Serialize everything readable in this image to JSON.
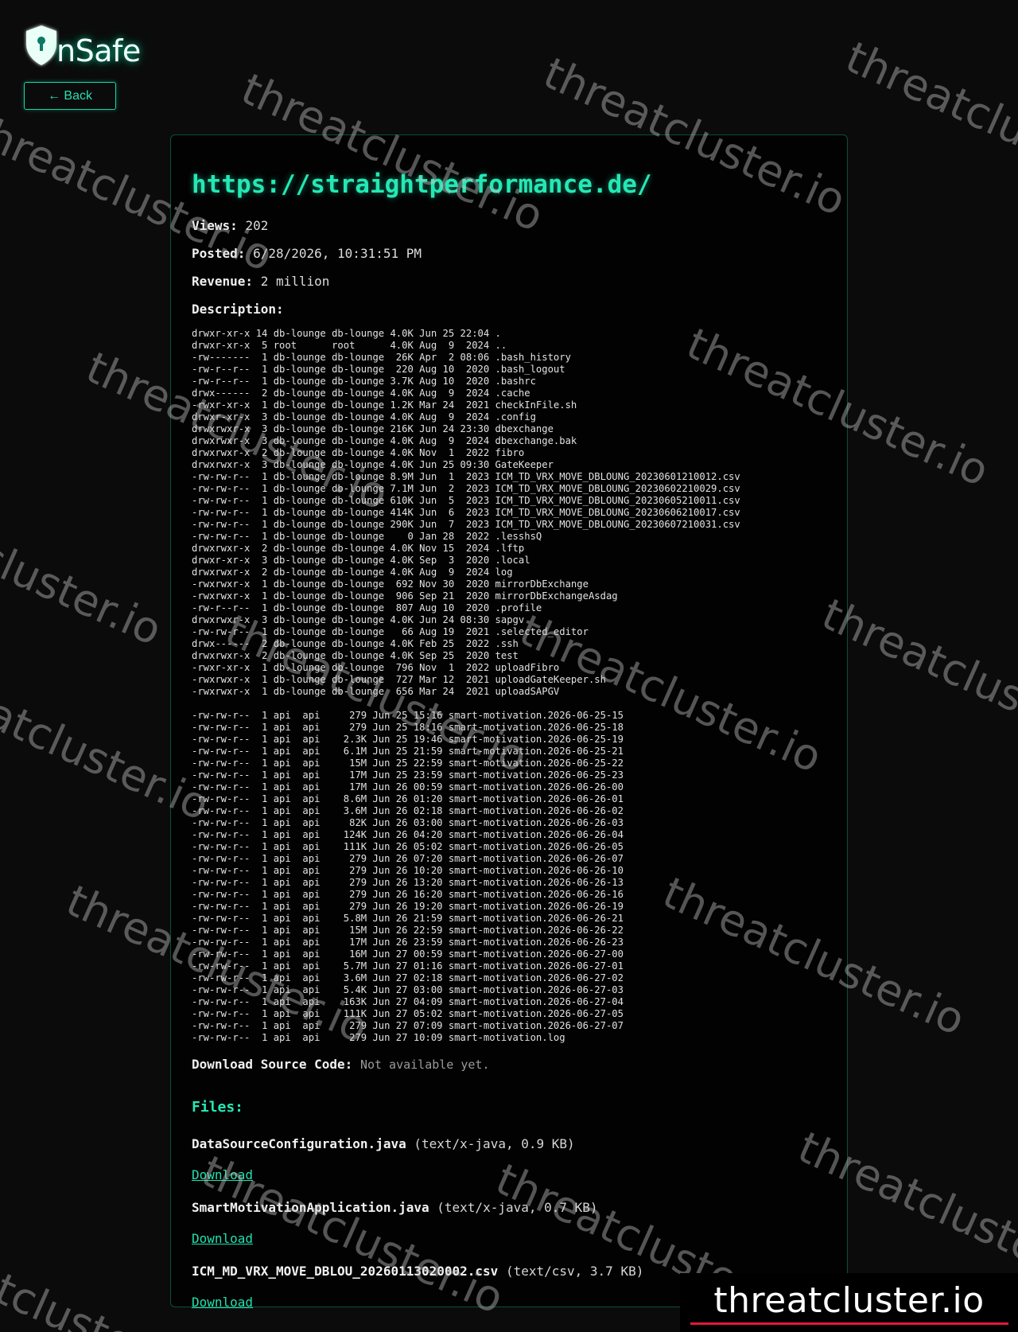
{
  "brand": {
    "name": "nSafe"
  },
  "nav": {
    "back_label": "← Back"
  },
  "post": {
    "url": "https://straightperformance.de/",
    "views_label": "Views:",
    "views": "202",
    "posted_label": "Posted:",
    "posted": "6/28/2026, 10:31:51 PM",
    "revenue_label": "Revenue:",
    "revenue": "2 million",
    "description_label": "Description:",
    "description": "drwxr-xr-x 14 db-lounge db-lounge 4.0K Jun 25 22:04 .\ndrwxr-xr-x  5 root      root      4.0K Aug  9  2024 ..\n-rw-------  1 db-lounge db-lounge  26K Apr  2 08:06 .bash_history\n-rw-r--r--  1 db-lounge db-lounge  220 Aug 10  2020 .bash_logout\n-rw-r--r--  1 db-lounge db-lounge 3.7K Aug 10  2020 .bashrc\ndrwx------  2 db-lounge db-lounge 4.0K Aug  9  2024 .cache\n-rwxr-xr-x  1 db-lounge db-lounge 1.2K Mar 24  2021 checkInFile.sh\ndrwxr-xr-x  3 db-lounge db-lounge 4.0K Aug  9  2024 .config\ndrwxrwxr-x  3 db-lounge db-lounge 216K Jun 24 23:30 dbexchange\ndrwxrwxr-x  3 db-lounge db-lounge 4.0K Aug  9  2024 dbexchange.bak\ndrwxrwxr-x  2 db-lounge db-lounge 4.0K Nov  1  2022 fibro\ndrwxrwxr-x  3 db-lounge db-lounge 4.0K Jun 25 09:30 GateKeeper\n-rw-rw-r--  1 db-lounge db-lounge 8.9M Jun  1  2023 ICM_TD_VRX_MOVE_DBLOUNG_20230601210012.csv\n-rw-rw-r--  1 db-lounge db-lounge 7.1M Jun  2  2023 ICM_TD_VRX_MOVE_DBLOUNG_20230602210029.csv\n-rw-rw-r--  1 db-lounge db-lounge 610K Jun  5  2023 ICM_TD_VRX_MOVE_DBLOUNG_20230605210011.csv\n-rw-rw-r--  1 db-lounge db-lounge 414K Jun  6  2023 ICM_TD_VRX_MOVE_DBLOUNG_20230606210017.csv\n-rw-rw-r--  1 db-lounge db-lounge 290K Jun  7  2023 ICM_TD_VRX_MOVE_DBLOUNG_20230607210031.csv\n-rw-rw-r--  1 db-lounge db-lounge    0 Jan 28  2022 .lesshsQ\ndrwxrwxr-x  2 db-lounge db-lounge 4.0K Nov 15  2024 .lftp\ndrwxr-xr-x  3 db-lounge db-lounge 4.0K Sep  3  2020 .local\ndrwxrwxr-x  2 db-lounge db-lounge 4.0K Aug  9  2024 log\n-rwxrwxr-x  1 db-lounge db-lounge  692 Nov 30  2020 mirrorDbExchange\n-rwxrwxr-x  1 db-lounge db-lounge  906 Sep 21  2020 mirrorDbExchangeAsdag\n-rw-r--r--  1 db-lounge db-lounge  807 Aug 10  2020 .profile\ndrwxrwxr-x  3 db-lounge db-lounge 4.0K Jun 24 08:30 sapgv\n-rw-rw-r--  1 db-lounge db-lounge   66 Aug 19  2021 .selected_editor\ndrwx------  2 db-lounge db-lounge 4.0K Feb 25  2022 .ssh\ndrwxrwxr-x  2 db-lounge db-lounge 4.0K Sep 25  2020 test\n-rwxr-xr-x  1 db-lounge db-lounge  796 Nov  1  2022 uploadFibro\n-rwxrwxr-x  1 db-lounge db-lounge  727 Mar 12  2021 uploadGateKeeper.sh\n-rwxrwxr-x  1 db-lounge db-lounge  656 Mar 24  2021 uploadSAPGV\n\n-rw-rw-r--  1 api  api     279 Jun 25 15:16 smart-motivation.2026-06-25-15\n-rw-rw-r--  1 api  api     279 Jun 25 18:16 smart-motivation.2026-06-25-18\n-rw-rw-r--  1 api  api    2.3K Jun 25 19:46 smart-motivation.2026-06-25-19\n-rw-rw-r--  1 api  api    6.1M Jun 25 21:59 smart-motivation.2026-06-25-21\n-rw-rw-r--  1 api  api     15M Jun 25 22:59 smart-motivation.2026-06-25-22\n-rw-rw-r--  1 api  api     17M Jun 25 23:59 smart-motivation.2026-06-25-23\n-rw-rw-r--  1 api  api     17M Jun 26 00:59 smart-motivation.2026-06-26-00\n-rw-rw-r--  1 api  api    8.6M Jun 26 01:20 smart-motivation.2026-06-26-01\n-rw-rw-r--  1 api  api    3.6M Jun 26 02:18 smart-motivation.2026-06-26-02\n-rw-rw-r--  1 api  api     82K Jun 26 03:00 smart-motivation.2026-06-26-03\n-rw-rw-r--  1 api  api    124K Jun 26 04:20 smart-motivation.2026-06-26-04\n-rw-rw-r--  1 api  api    111K Jun 26 05:02 smart-motivation.2026-06-26-05\n-rw-rw-r--  1 api  api     279 Jun 26 07:20 smart-motivation.2026-06-26-07\n-rw-rw-r--  1 api  api     279 Jun 26 10:20 smart-motivation.2026-06-26-10\n-rw-rw-r--  1 api  api     279 Jun 26 13:20 smart-motivation.2026-06-26-13\n-rw-rw-r--  1 api  api     279 Jun 26 16:20 smart-motivation.2026-06-26-16\n-rw-rw-r--  1 api  api     279 Jun 26 19:20 smart-motivation.2026-06-26-19\n-rw-rw-r--  1 api  api    5.8M Jun 26 21:59 smart-motivation.2026-06-26-21\n-rw-rw-r--  1 api  api     15M Jun 26 22:59 smart-motivation.2026-06-26-22\n-rw-rw-r--  1 api  api     17M Jun 26 23:59 smart-motivation.2026-06-26-23\n-rw-rw-r--  1 api  api     16M Jun 27 00:59 smart-motivation.2026-06-27-00\n-rw-rw-r--  1 api  api    5.7M Jun 27 01:16 smart-motivation.2026-06-27-01\n-rw-rw-r--  1 api  api    3.6M Jun 27 02:18 smart-motivation.2026-06-27-02\n-rw-rw-r--  1 api  api    5.4K Jun 27 03:00 smart-motivation.2026-06-27-03\n-rw-rw-r--  1 api  api    163K Jun 27 04:09 smart-motivation.2026-06-27-04\n-rw-rw-r--  1 api  api    111K Jun 27 05:02 smart-motivation.2026-06-27-05\n-rw-rw-r--  1 api  api     279 Jun 27 07:09 smart-motivation.2026-06-27-07\n-rw-rw-r--  1 api  api     279 Jun 27 10:09 smart-motivation.log",
    "source_label": "Download Source Code:",
    "source_value": "Not available yet.",
    "files_heading": "Files:",
    "files": [
      {
        "name": "DataSourceConfiguration.java",
        "meta": "(text/x-java, 0.9 KB)",
        "download_label": "Download"
      },
      {
        "name": "SmartMotivationApplication.java",
        "meta": "(text/x-java, 0.7 KB)",
        "download_label": "Download"
      },
      {
        "name": "ICM_MD_VRX_MOVE_DBLOU_20260113020002.csv",
        "meta": "(text/csv, 3.7 KB)",
        "download_label": "Download"
      }
    ]
  },
  "watermark": {
    "text": "threatcluster.io"
  },
  "corner_logo": {
    "text": "threatcluster.io",
    "accent_color": "#e3183a"
  },
  "colors": {
    "accent": "#24e8b5",
    "background": "#0b0b0b"
  },
  "icons": {
    "brand": "shield-keyhole-icon"
  }
}
